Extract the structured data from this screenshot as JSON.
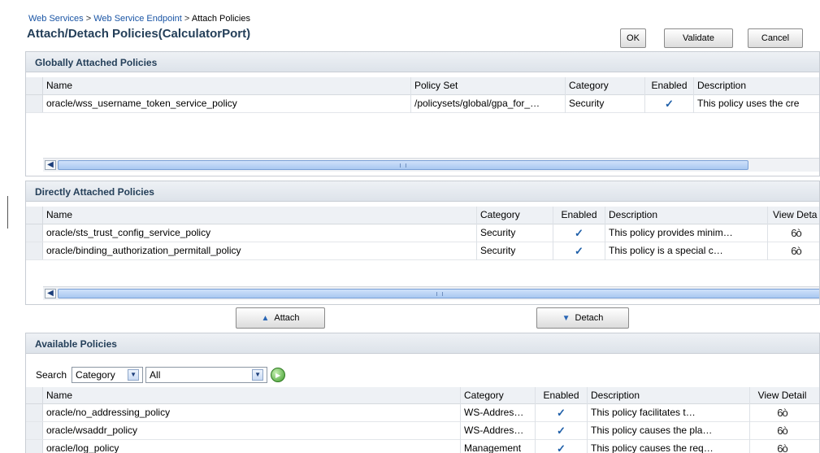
{
  "breadcrumb": {
    "items": [
      "Web Services",
      "Web Service Endpoint",
      "Attach Policies"
    ],
    "separator": ">"
  },
  "page_title": "Attach/Detach Policies(CalculatorPort)",
  "actions": {
    "ok": "OK",
    "validate": "Validate",
    "cancel": "Cancel"
  },
  "global_panel": {
    "title": "Globally Attached Policies",
    "columns": [
      "Name",
      "Policy Set",
      "Category",
      "Enabled",
      "Description"
    ],
    "rows": [
      {
        "name": "oracle/wss_username_token_service_policy",
        "policy_set": "/policysets/global/gpa_for_…",
        "category": "Security",
        "enabled": "✓",
        "description": "This policy uses the cre"
      }
    ]
  },
  "direct_panel": {
    "title": "Directly Attached Policies",
    "columns": [
      "Name",
      "Category",
      "Enabled",
      "Description",
      "View Deta"
    ],
    "rows": [
      {
        "name": "oracle/sts_trust_config_service_policy",
        "category": "Security",
        "enabled": "✓",
        "description": "This policy provides minim…",
        "view": "6ò"
      },
      {
        "name": "oracle/binding_authorization_permitall_policy",
        "category": "Security",
        "enabled": "✓",
        "description": "This policy is a special c…",
        "view": "6ò"
      }
    ]
  },
  "attach_label": "Attach",
  "detach_label": "Detach",
  "available_panel": {
    "title": "Available Policies",
    "search_label": "Search",
    "search_field": "Category",
    "search_value": "All",
    "columns": [
      "Name",
      "Category",
      "Enabled",
      "Description",
      "View Detail"
    ],
    "rows": [
      {
        "name": "oracle/no_addressing_policy",
        "category": "WS-Addres…",
        "enabled": "✓",
        "description": "This policy facilitates t…",
        "view": "6ò"
      },
      {
        "name": "oracle/wsaddr_policy",
        "category": "WS-Addres…",
        "enabled": "✓",
        "description": "This policy causes the pla…",
        "view": "6ò"
      },
      {
        "name": "oracle/log_policy",
        "category": "Management",
        "enabled": "✓",
        "description": "This policy causes the req…",
        "view": "6ò"
      }
    ]
  },
  "colors": {
    "link": "#1a55a5",
    "title": "#243f59",
    "check": "#1d5ea8"
  },
  "icons": [
    "attach-up-arrow-icon",
    "detach-down-arrow-icon",
    "view-detail-glasses-icon",
    "check-icon",
    "go-icon",
    "dropdown-arrow-icon",
    "scroll-left-icon"
  ]
}
